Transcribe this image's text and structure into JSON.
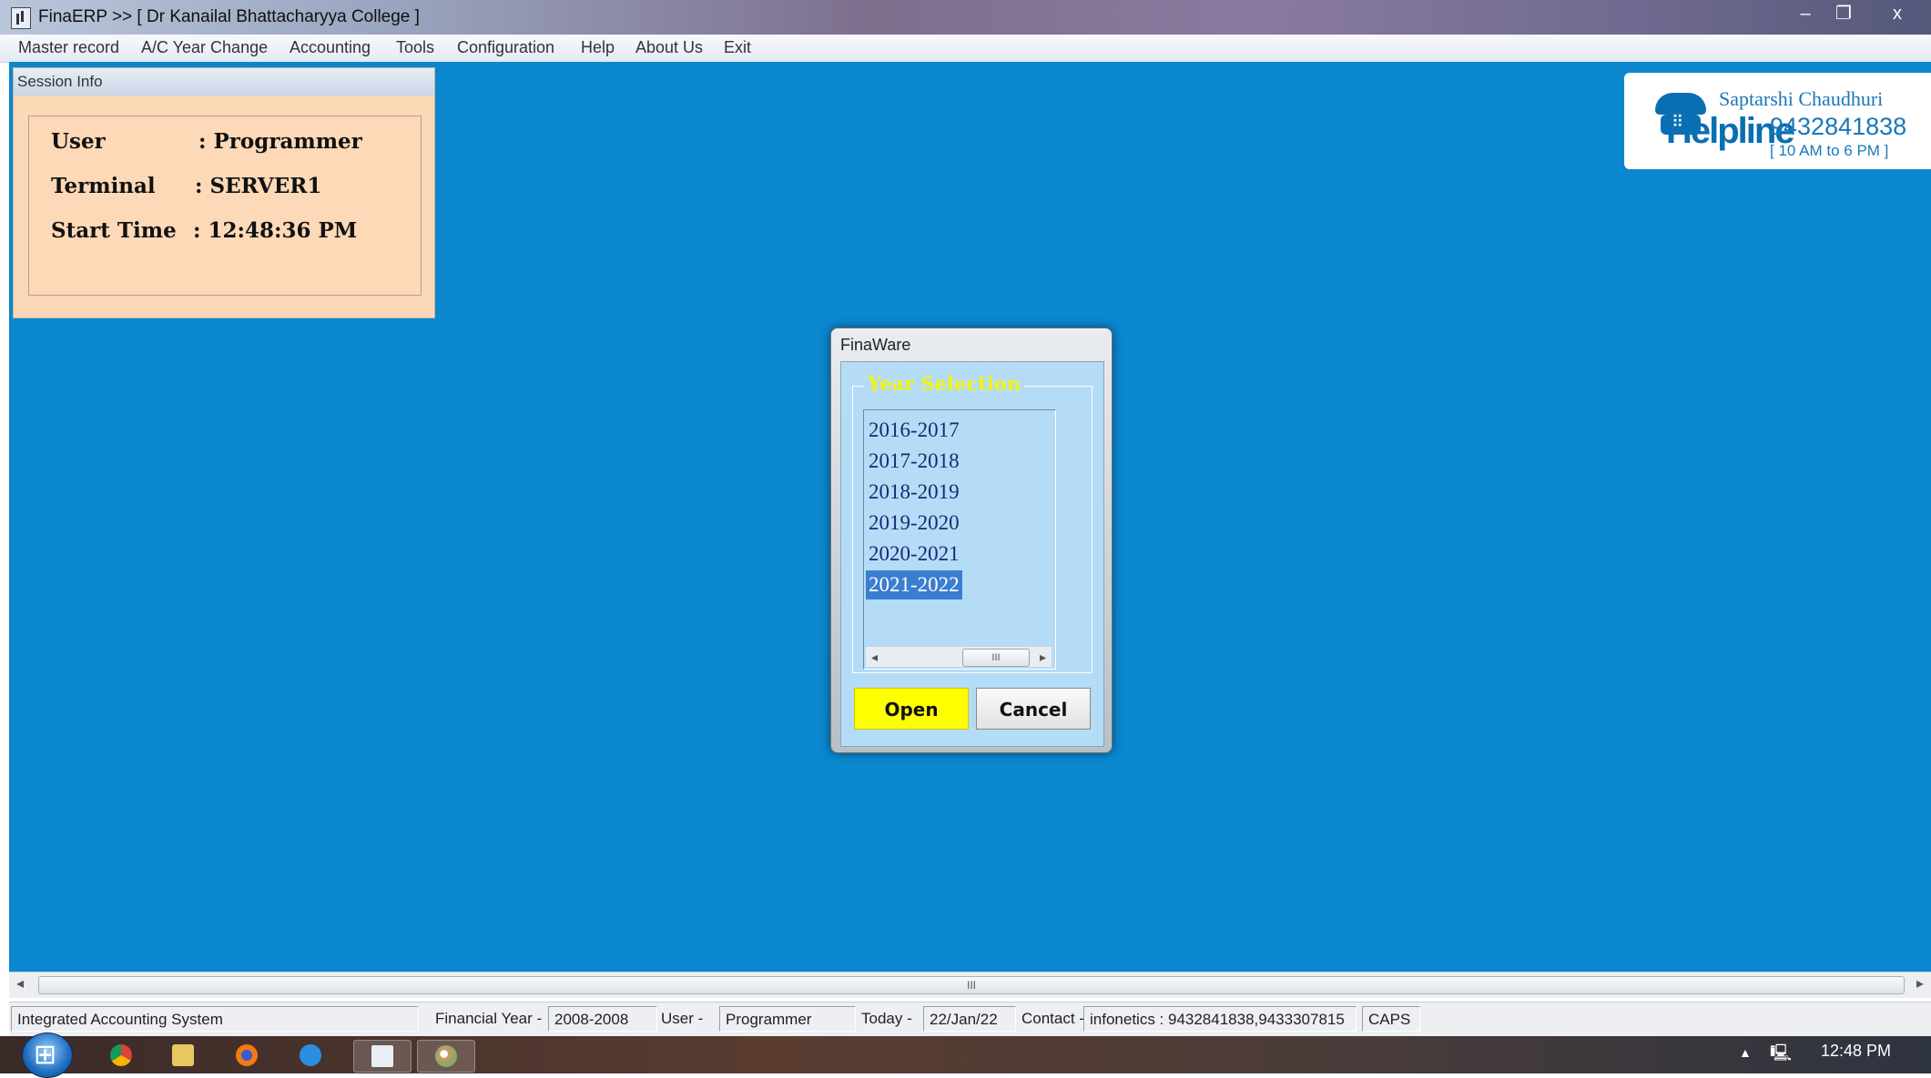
{
  "window": {
    "title": "FinaERP  >> [ Dr Kanailal Bhattacharyya College ]",
    "buttons": {
      "minimize": "–",
      "maximize": "❐",
      "close": "x"
    }
  },
  "menu": {
    "items": [
      "Master record",
      "A/C Year Change",
      "Accounting",
      "Tools",
      "Configuration",
      "Help",
      "About Us",
      "Exit"
    ]
  },
  "session": {
    "header": "Session Info",
    "user_label": "User",
    "user_value": ": Programmer",
    "terminal_label": "Terminal",
    "terminal_value": ": SERVER1",
    "start_label": "Start Time",
    "start_value": ": 12:48:36 PM"
  },
  "helpline": {
    "name": "Saptarshi Chaudhuri",
    "brand": "Helpline",
    "phone": "9432841838",
    "hours": "[ 10 AM to 6 PM ]"
  },
  "dialog": {
    "title": "FinaWare",
    "group_label": "Year Selection",
    "years": [
      "2016-2017",
      "2017-2018",
      "2018-2019",
      "2019-2020",
      "2020-2021",
      "2021-2022"
    ],
    "selected_index": 5,
    "open_label": "Open",
    "cancel_label": "Cancel",
    "scroll_grip": "III"
  },
  "mainscroll": {
    "grip": "III"
  },
  "status": {
    "system": "Integrated  Accounting  System",
    "fy_label": "Financial Year -",
    "fy_value": "2008-2008",
    "user_label": "User -",
    "user_value": "Programmer",
    "today_label": "Today -",
    "today_value": "22/Jan/22",
    "contact_label": "Contact -",
    "contact_value": "infonetics : 9432841838,9433307815",
    "caps": "CAPS"
  },
  "taskbar": {
    "apps": [
      "chrome-icon",
      "file-explorer-icon",
      "firefox-icon",
      "internet-explorer-icon",
      "finaerp-icon",
      "paint-icon"
    ],
    "clock": "12:48 PM"
  },
  "colors": {
    "desktop": "#0a87cf",
    "session_panel": "#fbd8b6",
    "dialog_client": "#b5dcf7",
    "open_button": "#ffff00",
    "group_label": "#f4f40e",
    "selected_item": "#3a7ecf"
  }
}
